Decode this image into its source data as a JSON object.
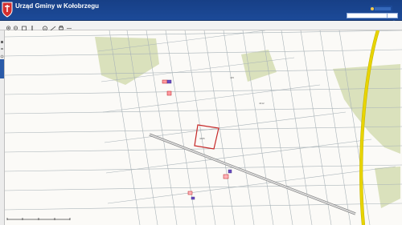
{
  "header": {
    "title": "Urząd Gminy w Kołobrzegu",
    "subtitle": "",
    "links": "",
    "logo_text": ""
  },
  "search": {
    "placeholder": "",
    "value": "",
    "button_icon": "search-icon"
  },
  "toolbar": {
    "tools": [
      {
        "name": "zoom-in-icon",
        "icon": "zoom-in-icon"
      },
      {
        "name": "zoom-out-icon",
        "icon": "zoom-out-icon"
      },
      {
        "name": "full-extent-icon",
        "icon": "full-extent-icon"
      },
      {
        "name": "pan-icon",
        "icon": "pan-icon"
      },
      {
        "name": "identify-icon",
        "icon": "identify-icon"
      },
      {
        "name": "measure-icon",
        "icon": "measure-icon"
      },
      {
        "name": "print-icon",
        "icon": "print-icon"
      },
      {
        "name": "more-icon",
        "icon": "more-icon"
      }
    ]
  },
  "left_panel": {
    "tab_icon": "layers-icon",
    "icons": [
      "legend-icon",
      "layers-icon",
      "settings-icon"
    ]
  },
  "map": {
    "parcels": [
      {
        "label": "4405"
      },
      {
        "label": "4412"
      },
      {
        "label": "445"
      }
    ]
  },
  "status": {
    "left_text": "",
    "attribution": ""
  },
  "colors": {
    "header": "#1c4a98",
    "toolbar": "#f2f2f2",
    "map_bg": "#fbfaf7",
    "forest": "#d8dfb8",
    "road": "#e8d400",
    "road_edge": "#bfb000",
    "parcel_line": "#a9b3b8",
    "highlight": "#c62828"
  }
}
